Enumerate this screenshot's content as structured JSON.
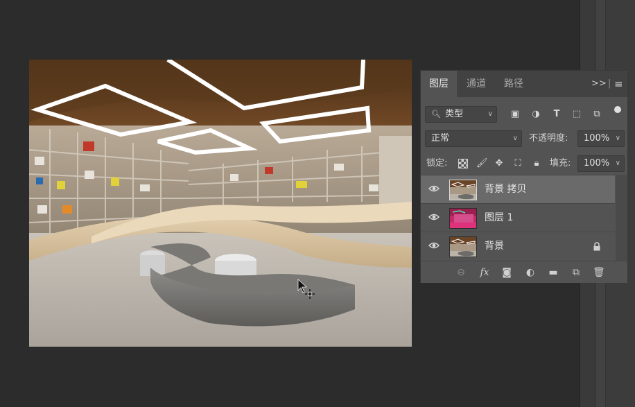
{
  "layers_panel": {
    "tabs": [
      "图层",
      "通道",
      "路径"
    ],
    "tab_overflow": ">>",
    "filter": {
      "value": "类型"
    },
    "blend_mode": {
      "value": "正常"
    },
    "opacity": {
      "label": "不透明度:",
      "value": "100%"
    },
    "lock": {
      "label": "锁定:"
    },
    "fill": {
      "label": "填充:",
      "value": "100%"
    },
    "layers": [
      {
        "name": "背景 拷贝",
        "visible": true,
        "selected": true,
        "locked": false
      },
      {
        "name": "图层 1",
        "visible": true,
        "selected": false,
        "locked": false
      },
      {
        "name": "背景",
        "visible": true,
        "selected": false,
        "locked": true
      }
    ],
    "footer_fx": "fx"
  },
  "colors": {
    "app_bg": "#2c2c2c",
    "panel_bg": "#535353",
    "selected_layer": "#6a6a6a"
  }
}
